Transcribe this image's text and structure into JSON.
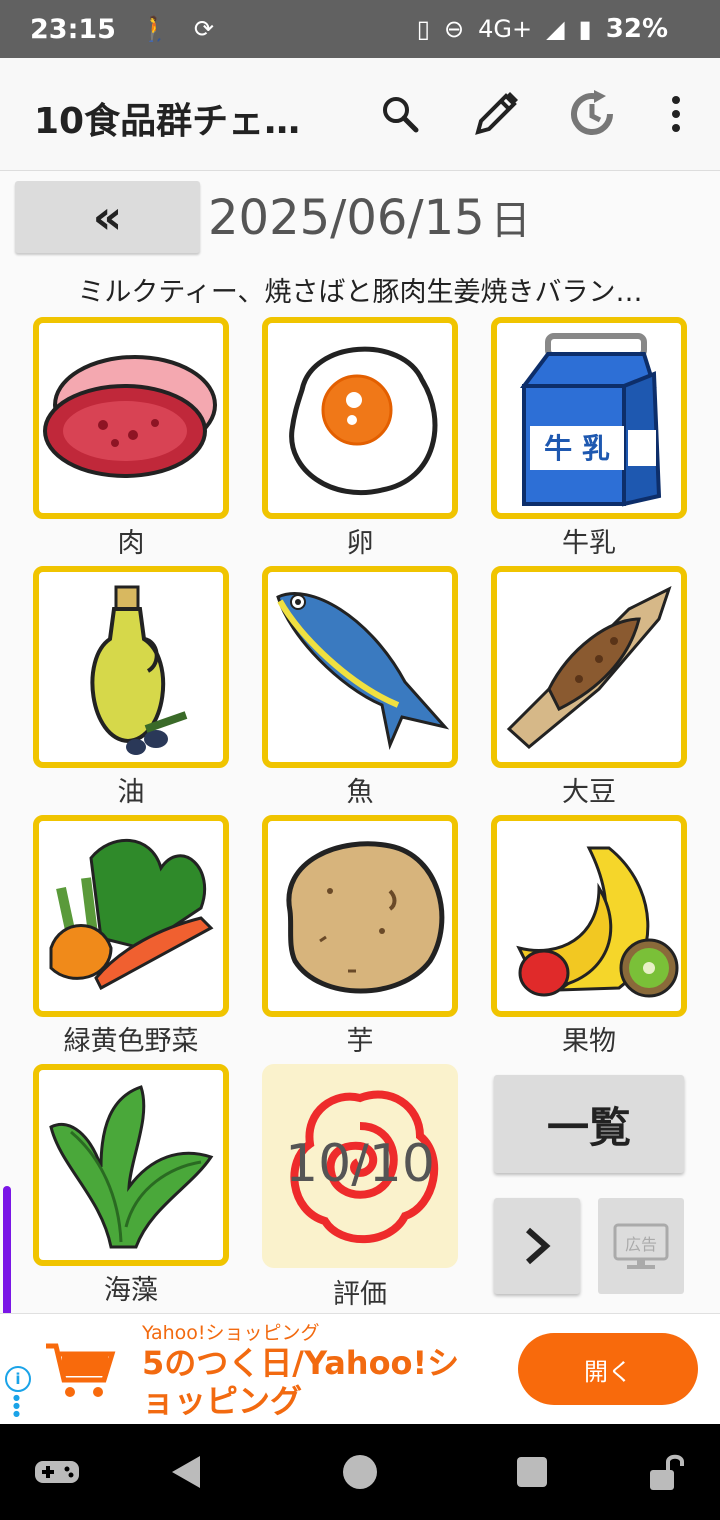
{
  "status_bar": {
    "time": "23:15",
    "network": "4G+",
    "battery": "32%"
  },
  "app_bar": {
    "title": "10食品群チェ…",
    "icons": [
      "search-icon",
      "edit-icon",
      "history-icon",
      "more-vert-icon"
    ]
  },
  "date_bar": {
    "back_label": "«",
    "date": "2025/06/15",
    "weekday": "日"
  },
  "summary": "ミルクティー、焼さばと豚肉生姜焼きバラン…",
  "foods": [
    {
      "label": "肉",
      "icon": "meat-icon"
    },
    {
      "label": "卵",
      "icon": "egg-icon"
    },
    {
      "label": "牛乳",
      "icon": "milk-carton-icon",
      "carton_text": "牛 乳"
    },
    {
      "label": "油",
      "icon": "olive-oil-icon"
    },
    {
      "label": "魚",
      "icon": "fish-icon"
    },
    {
      "label": "大豆",
      "icon": "natto-icon"
    },
    {
      "label": "緑黄色野菜",
      "icon": "vegetables-icon"
    },
    {
      "label": "芋",
      "icon": "potato-icon"
    },
    {
      "label": "果物",
      "icon": "fruits-icon"
    },
    {
      "label": "海藻",
      "icon": "seaweed-icon"
    }
  ],
  "evaluation": {
    "score": "10/10",
    "label": "評価",
    "icon": "hanamaru-icon"
  },
  "buttons": {
    "list_label": "一覧",
    "next_label": "›",
    "ad_label": "広告"
  },
  "ad": {
    "source": "Yahoo!ショッピング",
    "headline": "5のつく日/Yahoo!ショッピング",
    "cta": "開く"
  },
  "colors": {
    "card_border": "#f0c400",
    "evaluation_bg": "#faf2cc",
    "ad_accent": "#f86a0c",
    "status_bar": "#616161"
  }
}
